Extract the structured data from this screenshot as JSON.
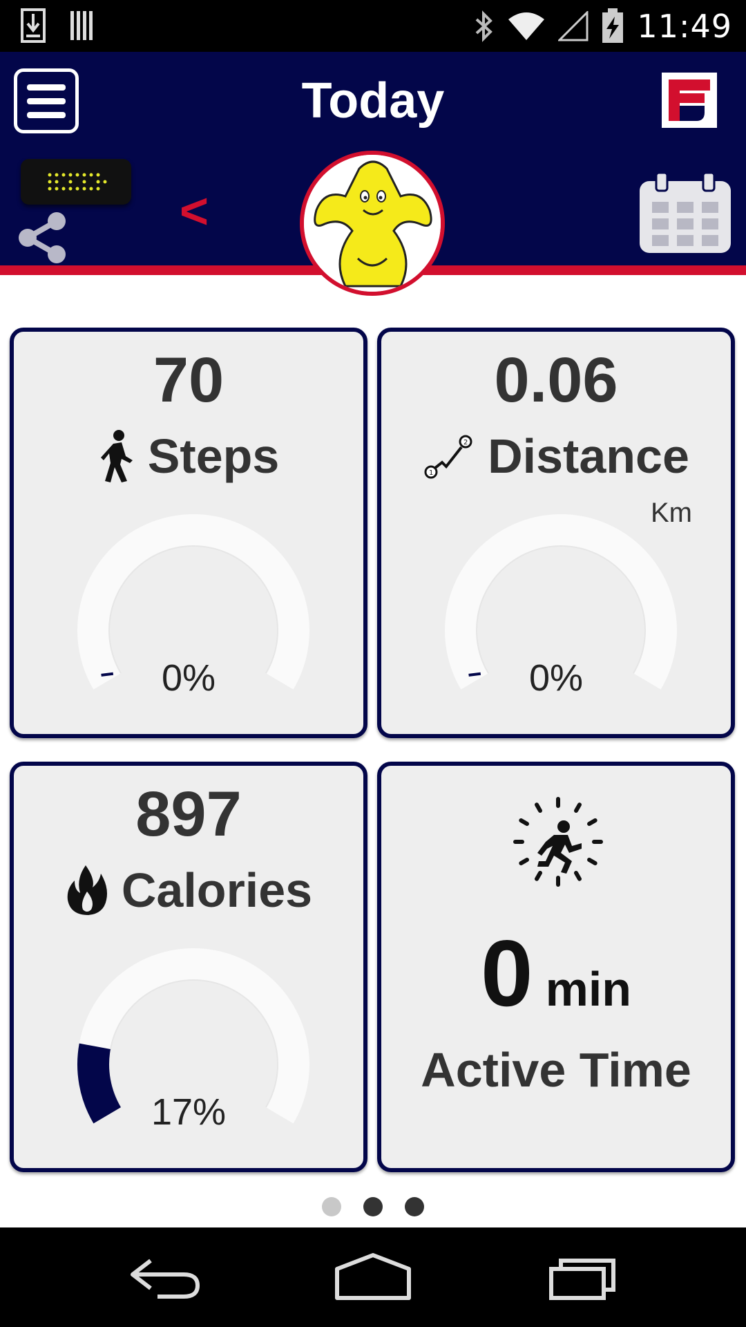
{
  "status_bar": {
    "time": "11:49",
    "icons": [
      "download-icon",
      "barcode-icon",
      "bluetooth-icon",
      "wifi-icon",
      "signal-icon",
      "battery-charging-icon"
    ]
  },
  "header": {
    "title": "Today",
    "menu_icon": "hamburger-icon",
    "logo": "brand-logo"
  },
  "subheader": {
    "back_symbol": "<",
    "icons": [
      "device-icon",
      "share-icon",
      "mascot-avatar",
      "calendar-icon"
    ]
  },
  "cards": {
    "steps": {
      "value": "70",
      "label": "Steps",
      "percent_text": "0%",
      "progress": 0.0,
      "icon": "walking-person-icon"
    },
    "distance": {
      "value": "0.06",
      "label": "Distance",
      "unit": "Km",
      "percent_text": "0%",
      "progress": 0.0,
      "icon": "distance-route-icon"
    },
    "calories": {
      "value": "897",
      "label": "Calories",
      "percent_text": "17%",
      "progress": 0.17,
      "icon": "flame-icon"
    },
    "active_time": {
      "value": "0",
      "unit": "min",
      "label": "Active Time",
      "icon": "running-clock-icon"
    }
  },
  "pager": {
    "count": 3,
    "active_index": 0
  },
  "colors": {
    "navy": "#03064a",
    "accent_red": "#d20f2e",
    "card_bg": "#eeeeee"
  },
  "nav_bar": {
    "icons": [
      "back-icon",
      "home-icon",
      "recents-icon"
    ]
  }
}
